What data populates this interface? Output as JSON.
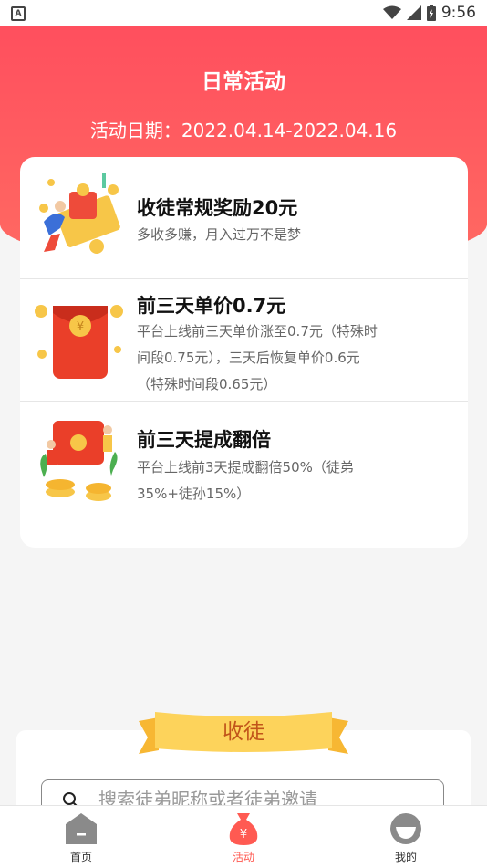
{
  "status_bar": {
    "time": "9:56",
    "app_icon_letter": "A"
  },
  "header": {
    "title": "日常活动",
    "date": "活动日期：2022.04.14-2022.04.16"
  },
  "rewards": [
    {
      "title": "收徒常规奖励20元",
      "desc": "多收多赚，月入过万不是梦",
      "illustration": "coins-illustration"
    },
    {
      "title": "前三天单价0.7元",
      "desc": "平台上线前三天单价涨至0.7元（特殊时间段0.75元），三天后恢复单价0.6元（特殊时间段0.65元）",
      "illustration": "red-envelope-illustration"
    },
    {
      "title": "前三天提成翻倍",
      "desc": "平台上线前3天提成翻倍50%（徒弟35%+徒孙15%）",
      "illustration": "people-coins-illustration"
    }
  ],
  "recruit": {
    "title": "收徒",
    "search_placeholder": "搜索徒弟昵称或者徒弟邀请"
  },
  "tabs": [
    {
      "label": "首页",
      "icon": "home-icon",
      "active": false
    },
    {
      "label": "活动",
      "icon": "money-bag-icon",
      "active": true
    },
    {
      "label": "我的",
      "icon": "profile-icon",
      "active": false
    }
  ],
  "colors": {
    "brand_red": "#ff4f5e",
    "active_tab": "#ff5a52",
    "inactive_tab": "#8a8a8a"
  }
}
